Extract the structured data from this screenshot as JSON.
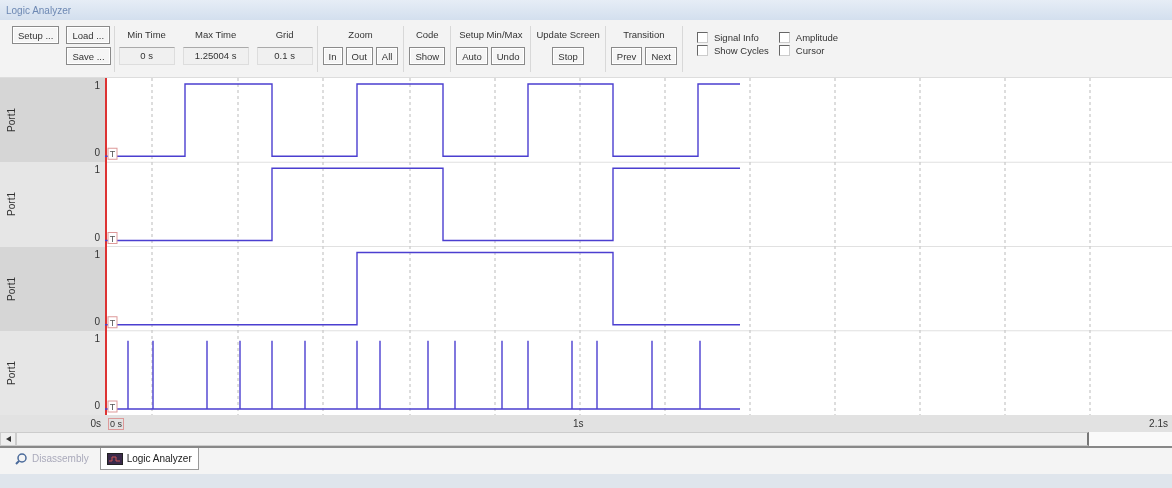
{
  "window": {
    "title": "Logic Analyzer"
  },
  "toolbar": {
    "file_buttons": [
      "Setup ...",
      "Load ...",
      "Save ..."
    ],
    "fields": [
      {
        "label": "Min Time",
        "value": "0 s"
      },
      {
        "label": "Max Time",
        "value": "1.25004 s"
      },
      {
        "label": "Grid",
        "value": "0.1 s"
      }
    ],
    "button_groups": [
      {
        "label": "Zoom",
        "buttons": [
          "In",
          "Out",
          "All"
        ]
      },
      {
        "label": "Code",
        "buttons": [
          "Show"
        ]
      },
      {
        "label": "Setup Min/Max",
        "buttons": [
          "Auto",
          "Undo"
        ]
      },
      {
        "label": "Update Screen",
        "buttons": [
          "Stop"
        ]
      },
      {
        "label": "Transition",
        "buttons": [
          "Prev",
          "Next"
        ]
      }
    ],
    "checkboxes": [
      {
        "label": "Signal Info",
        "checked": false
      },
      {
        "label": "Amplitude",
        "checked": false
      },
      {
        "label": "Show Cycles",
        "checked": false
      },
      {
        "label": "Cursor",
        "checked": false
      }
    ]
  },
  "signals": [
    {
      "name": "Port1",
      "high": "1",
      "low": "0",
      "marker": "T"
    },
    {
      "name": "Port1",
      "high": "1",
      "low": "0",
      "marker": "T"
    },
    {
      "name": "Port1",
      "high": "1",
      "low": "0",
      "marker": "T"
    },
    {
      "name": "Port1",
      "high": "1",
      "low": "0",
      "marker": "T"
    }
  ],
  "time_axis": {
    "start": "0s",
    "cursor": "0 s",
    "mid": "1s",
    "end": "2.1s"
  },
  "tabs": [
    {
      "label": "Disassembly",
      "selected": false
    },
    {
      "label": "Logic Analyzer",
      "selected": true
    }
  ]
}
